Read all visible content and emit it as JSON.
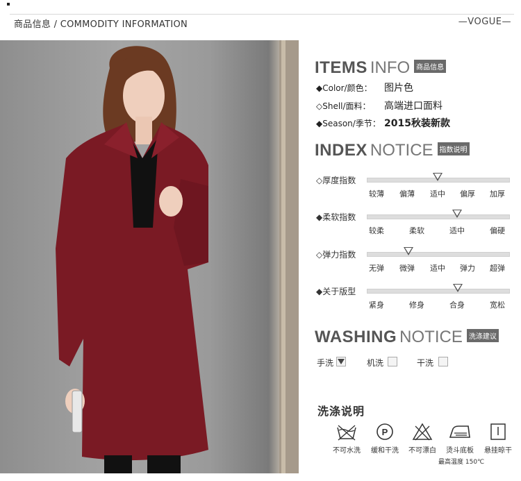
{
  "header": {
    "title": "商品信息 / COMMODITY INFORMATION",
    "right_label": "—VOGUE—"
  },
  "items_info": {
    "title_bold": "ITEMS",
    "title_light": "INFO",
    "tag": "商品信息",
    "rows": [
      {
        "label": "◆Color/颜色：",
        "value": "图片色"
      },
      {
        "label": "◇Shell/面料：",
        "value": "高端进口面料"
      },
      {
        "label": "◆Season/季节：",
        "value": "2015秋装新款"
      }
    ]
  },
  "index_notice": {
    "title_bold": "INDEX",
    "title_light": "NOTICE",
    "tag": "指数说明",
    "scales": [
      {
        "label": "◇厚度指数",
        "options": [
          "较薄",
          "偏薄",
          "适中",
          "偏厚",
          "加厚"
        ],
        "selected_index": 2
      },
      {
        "label": "◆柔软指数",
        "options": [
          "较柔",
          "柔软",
          "适中",
          "偏硬"
        ],
        "selected_index": 2
      },
      {
        "label": "◇弹力指数",
        "options": [
          "无弹",
          "微弹",
          "适中",
          "弹力",
          "超弹"
        ],
        "selected_index": 1
      },
      {
        "label": "◆关于版型",
        "options": [
          "紧身",
          "修身",
          "合身",
          "宽松"
        ],
        "selected_index": 2
      }
    ]
  },
  "washing_notice": {
    "title_bold": "WASHING",
    "title_light": "NOTICE",
    "tag": "洗涤建议",
    "options": [
      {
        "label": "手洗",
        "checked": true
      },
      {
        "label": "机洗",
        "checked": false
      },
      {
        "label": "干洗",
        "checked": false
      }
    ]
  },
  "care": {
    "title": "洗涤说明",
    "icons": [
      {
        "icon": "no-water-wash-icon",
        "label": "不可水洗"
      },
      {
        "icon": "gentle-dry-clean-icon",
        "label": "缓和干洗"
      },
      {
        "icon": "no-bleach-icon",
        "label": "不可漂白"
      },
      {
        "icon": "iron-icon",
        "label": "烫斗底板"
      },
      {
        "icon": "hang-dry-icon",
        "label": "悬挂晾干"
      }
    ],
    "iron_note": "最高温度 150℃"
  }
}
